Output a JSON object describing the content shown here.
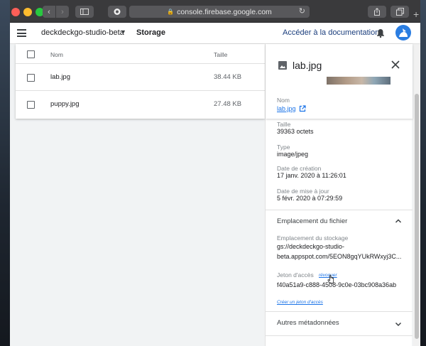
{
  "browser": {
    "url": "console.firebase.google.com",
    "lock_glyph": "🔒",
    "reload_glyph": "↻",
    "back_glyph": "‹",
    "forward_glyph": "›",
    "new_tab_glyph": "+"
  },
  "appbar": {
    "project": "deckdeckgo-studio-beta",
    "section": "Storage",
    "docs_link": "Accéder à la documentation"
  },
  "table": {
    "header": {
      "name": "Nom",
      "size": "Taille"
    },
    "rows": [
      {
        "name": "lab.jpg",
        "size": "38.44 KB"
      },
      {
        "name": "puppy.jpg",
        "size": "27.48 KB"
      }
    ]
  },
  "detail": {
    "title": "lab.jpg",
    "name_label": "Nom",
    "name_value": "lab.jpg",
    "size_label": "Taille",
    "size_value": "39363 octets",
    "type_label": "Type",
    "type_value": "image/jpeg",
    "created_label": "Date de création",
    "created_value": "17 janv. 2020 à 11:26:01",
    "updated_label": "Date de mise à jour",
    "updated_value": "5 févr. 2020 à 07:29:59",
    "location_section": "Emplacement du fichier",
    "storage_label": "Emplacement du stockage",
    "storage_line1": "gs://deckdeckgo-studio-",
    "storage_line2": "beta.appspot.com/5EON8gqYUkRWxyj3C...",
    "token_label": "Jeton d'accès",
    "revoke_link": "révoquer",
    "token_value": "f40a51a9-c888-4508-9c0e-03bc908a36ab",
    "create_token_link": "Créer un jeton d'accès",
    "other_section": "Autres métadonnées"
  },
  "colors": {
    "accent": "#1a73e8",
    "avatar_bg": "#2a7de1",
    "traffic_red": "#fe5f57",
    "traffic_yellow": "#febc2e",
    "traffic_green": "#28c840"
  }
}
